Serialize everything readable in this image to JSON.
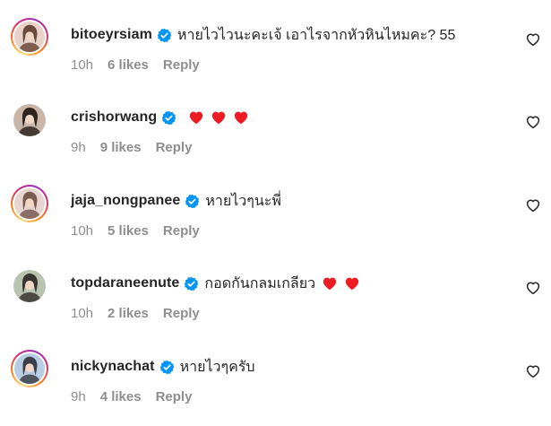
{
  "comments": [
    {
      "username": "bitoeyrsiam",
      "text": "หายไวไวนะคะเจ้ เอาไรจากหัวหินไหมคะ? 55",
      "hearts": 0,
      "time": "10h",
      "likes": "6 likes",
      "reply": "Reply",
      "story_ring": true,
      "avatar_colors": [
        "#e8d2c9",
        "#6b4a3c"
      ]
    },
    {
      "username": "crishorwang",
      "text": "",
      "hearts": 3,
      "time": "9h",
      "likes": "9 likes",
      "reply": "Reply",
      "story_ring": false,
      "avatar_colors": [
        "#c9b6a8",
        "#2f2420"
      ]
    },
    {
      "username": "jaja_nongpanee",
      "text": "หายไวๆนะพี่",
      "hearts": 0,
      "time": "10h",
      "likes": "5 likes",
      "reply": "Reply",
      "story_ring": true,
      "avatar_colors": [
        "#e6d5d0",
        "#7a5b52"
      ]
    },
    {
      "username": "topdaraneenute",
      "text": "กอดกันกลมเกลียว",
      "hearts": 2,
      "time": "10h",
      "likes": "2 likes",
      "reply": "Reply",
      "story_ring": false,
      "avatar_colors": [
        "#b9c4b0",
        "#3a3530"
      ]
    },
    {
      "username": "nickynachat",
      "text": "หายไวๆครับ",
      "hearts": 0,
      "time": "9h",
      "likes": "4 likes",
      "reply": "Reply",
      "story_ring": true,
      "avatar_colors": [
        "#b7cde4",
        "#3c3f4a"
      ]
    }
  ],
  "icons": {
    "verified": "verified-badge-icon",
    "like": "heart-outline-icon",
    "heart_emoji": "red-heart-emoji-icon"
  },
  "colors": {
    "verified_blue": "#0095f6",
    "heart_red": "#ed1c24",
    "meta_gray": "#8e8e8e",
    "text": "#262626"
  }
}
